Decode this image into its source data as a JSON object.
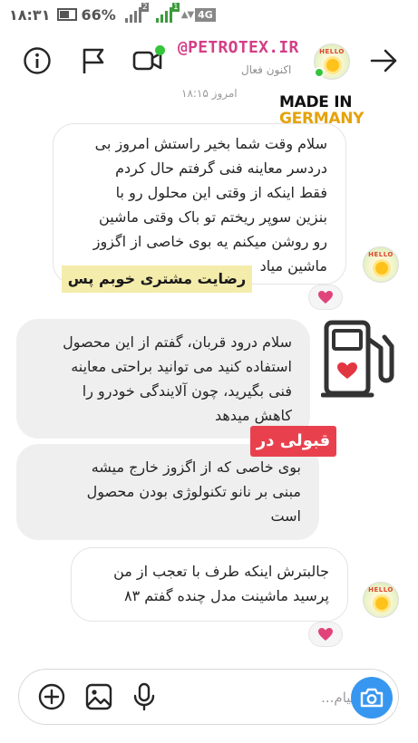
{
  "status_bar": {
    "time": "۱۸:۳۱",
    "battery": "66%",
    "sim1_badge": "2",
    "sim2_badge": "1",
    "network": "4G"
  },
  "header": {
    "username": "@PETROTEX.IR",
    "status": "اکنون فعال",
    "icons": [
      "info-icon",
      "flag-icon",
      "video-call-icon",
      "back-arrow-icon"
    ],
    "accent_color": "#d33f86"
  },
  "chat": {
    "timestamp": "امروز ۱۸:۱۵",
    "made_in": {
      "line1": "MADE IN",
      "line2": "GERMANY"
    },
    "messages": [
      {
        "direction": "incoming",
        "text": "سلام وقت شما بخیر راستش امروز بی\nدردسر معاینه فنی گرفتم حال کردم\nفقط اینکه از وقتی این محلول رو با\nبنزین سوپر ریختم تو باک وقتی ماشین\nرو روشن میکنم یه بوی خاصی از اگزوز\nماشین میاد",
        "reaction": "heart"
      },
      {
        "direction": "outgoing",
        "text": "سلام درود قربان، گفتم از این محصول\nاستفاده کنید می توانید براحتی معاینه\nفنی بگیرید، چون آلایندگی خودرو را\nکاهش میدهد"
      },
      {
        "direction": "outgoing",
        "text": "بوی خاصی که از اگزوز خارج میشه\nمبنی بر نانو تکنولوژی بودن محصول\nاست"
      },
      {
        "direction": "incoming",
        "text": "جالبترش اینکه طرف با تعجب از من\nپرسید ماشینت مدل چنده گفتم ۸۳",
        "reaction": "heart"
      }
    ],
    "overlay_yellow": "رضایت مشتری خوبم پس",
    "overlay_red": "قبولی در",
    "reaction_color": "#e0447a"
  },
  "composer": {
    "placeholder": "پیام...",
    "buttons": [
      "add-icon",
      "gallery-icon",
      "mic-icon",
      "camera-icon"
    ],
    "camera_color": "#3797f0"
  }
}
